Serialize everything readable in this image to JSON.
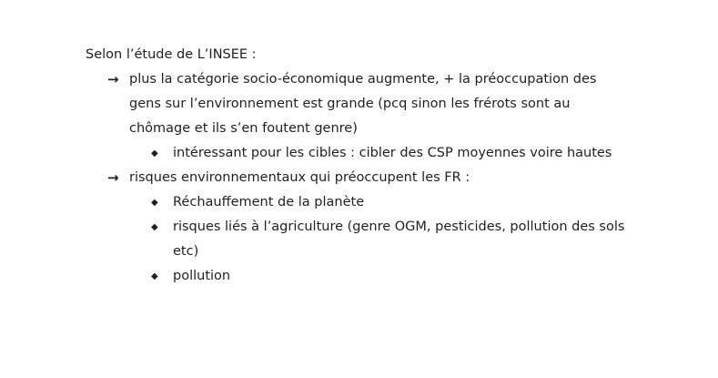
{
  "intro": "Selon l’étude de L’INSEE :",
  "items": [
    {
      "text": "plus la catégorie socio-économique augmente, + la préoccupation des gens sur l’environnement est grande (pcq sinon les frérots sont au chômage et ils s’en foutent genre)",
      "subitems": [
        "intéressant pour les cibles : cibler des CSP moyennes voire hautes"
      ]
    },
    {
      "text": "risques environnementaux qui préoccupent les FR :",
      "subitems": [
        "Réchauffement de la planète",
        "risques liés à l’agriculture (genre OGM, pesticides, pollution des sols etc)",
        "pollution"
      ]
    }
  ],
  "icons": {
    "arrow": "→",
    "diamond": "◆"
  }
}
